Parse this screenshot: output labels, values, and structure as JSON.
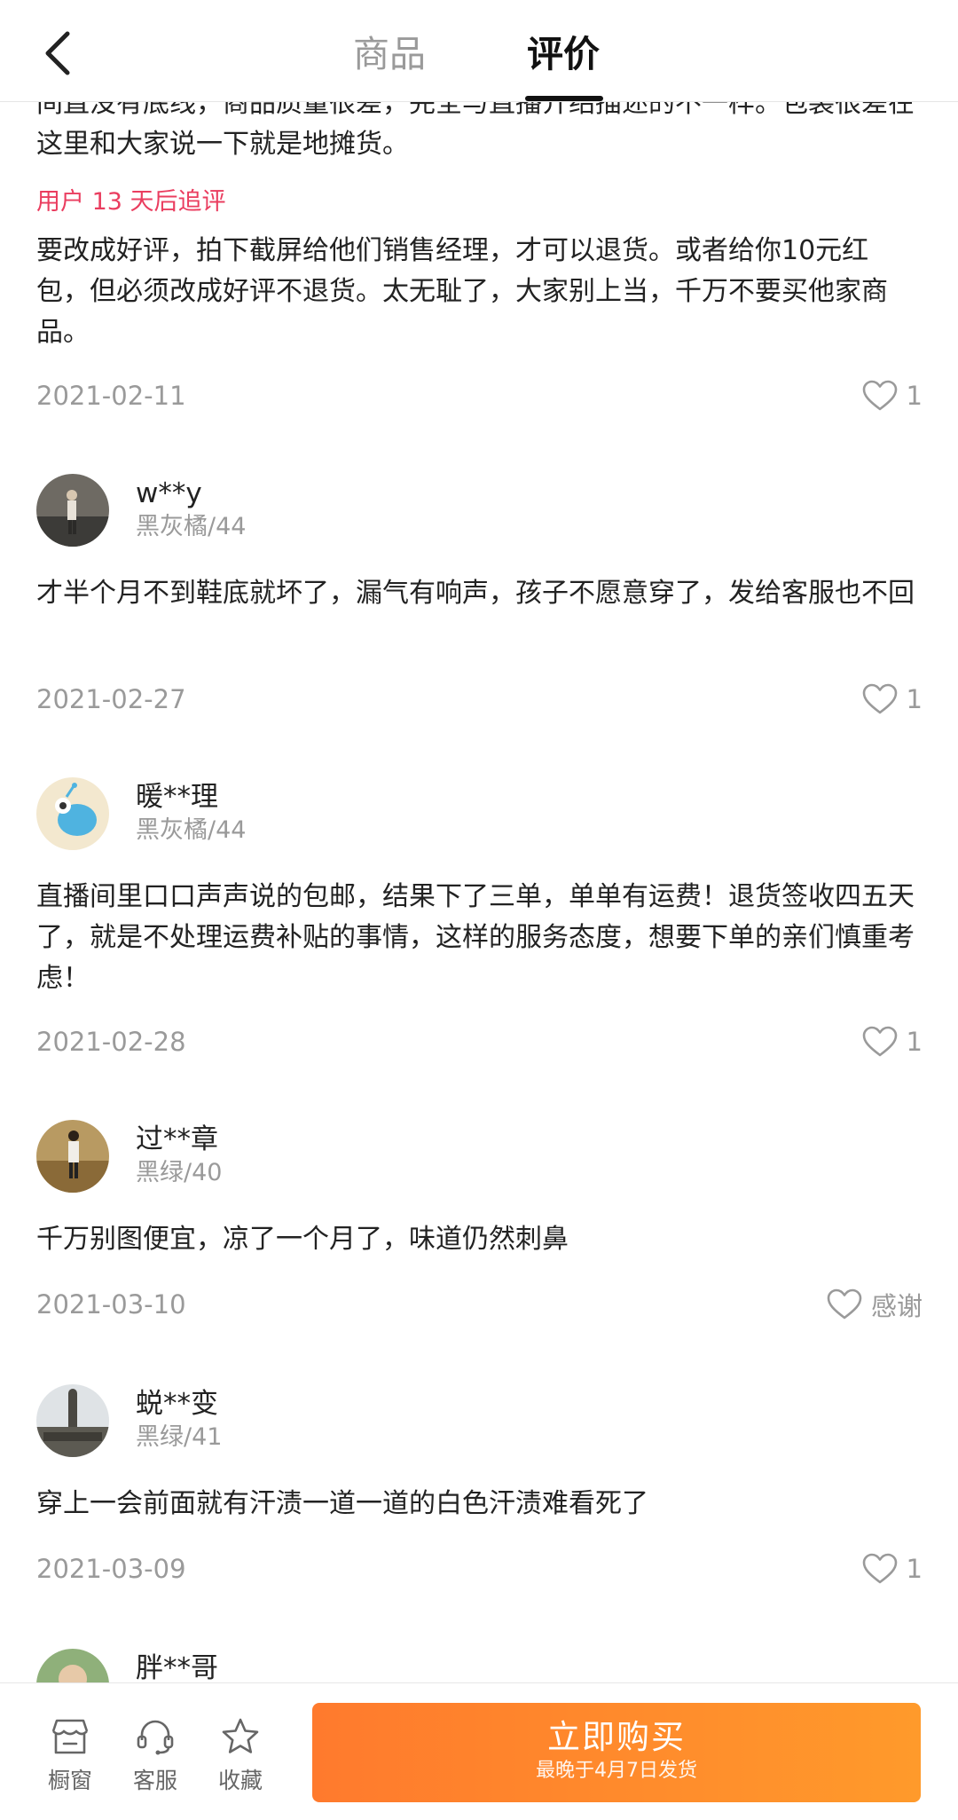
{
  "header": {
    "tabs": [
      {
        "label": "商品"
      },
      {
        "label": "评价"
      }
    ],
    "active_tab": "评价"
  },
  "reviews": [
    {
      "text_partial": "间直没有底线，商品质量很差，完全与直播介绍描述的不一样。包装很差在这里和大家说一下就是地摊货。",
      "followup_label": "用户 13 天后追评",
      "followup_text": "要改成好评，拍下截屏给他们销售经理，才可以退货。或者给你10元红包，但必须改成好评不退货。太无耻了，大家别上当，千万不要买他家商品。",
      "date": "2021-02-11",
      "likes": "1"
    },
    {
      "user": "w**y",
      "spec": "黑灰橘/44",
      "text": "才半个月不到鞋底就坏了，漏气有响声，孩子不愿意穿了，发给客服也不回",
      "date": "2021-02-27",
      "likes": "1"
    },
    {
      "user": "暖**理",
      "spec": "黑灰橘/44",
      "text": "直播间里口口声声说的包邮，结果下了三单，单单有运费！退货签收四五天了，就是不处理运费补贴的事情，这样的服务态度，想要下单的亲们慎重考虑！",
      "date": "2021-02-28",
      "likes": "1"
    },
    {
      "user": "过**章",
      "spec": "黑绿/40",
      "text": "千万别图便宜，凉了一个月了，味道仍然刺鼻",
      "date": "2021-03-10",
      "likes": "感谢"
    },
    {
      "user": "蜕**变",
      "spec": "黑绿/41",
      "text": "穿上一会前面就有汗渍一道一道的白色汗渍难看死了",
      "date": "2021-03-09",
      "likes": "1"
    },
    {
      "user": "胖**哥"
    }
  ],
  "bottom_bar": {
    "items": [
      {
        "label": "橱窗",
        "icon": "shop-window-icon"
      },
      {
        "label": "客服",
        "icon": "headset-icon"
      },
      {
        "label": "收藏",
        "icon": "star-icon"
      }
    ],
    "buy_label": "立即购买",
    "ship_note": "最晚于4月7日发货"
  },
  "colors": {
    "accent": "#ff8a2b",
    "followup_label": "#ea3d5f",
    "muted_text": "#9a9a9a"
  }
}
